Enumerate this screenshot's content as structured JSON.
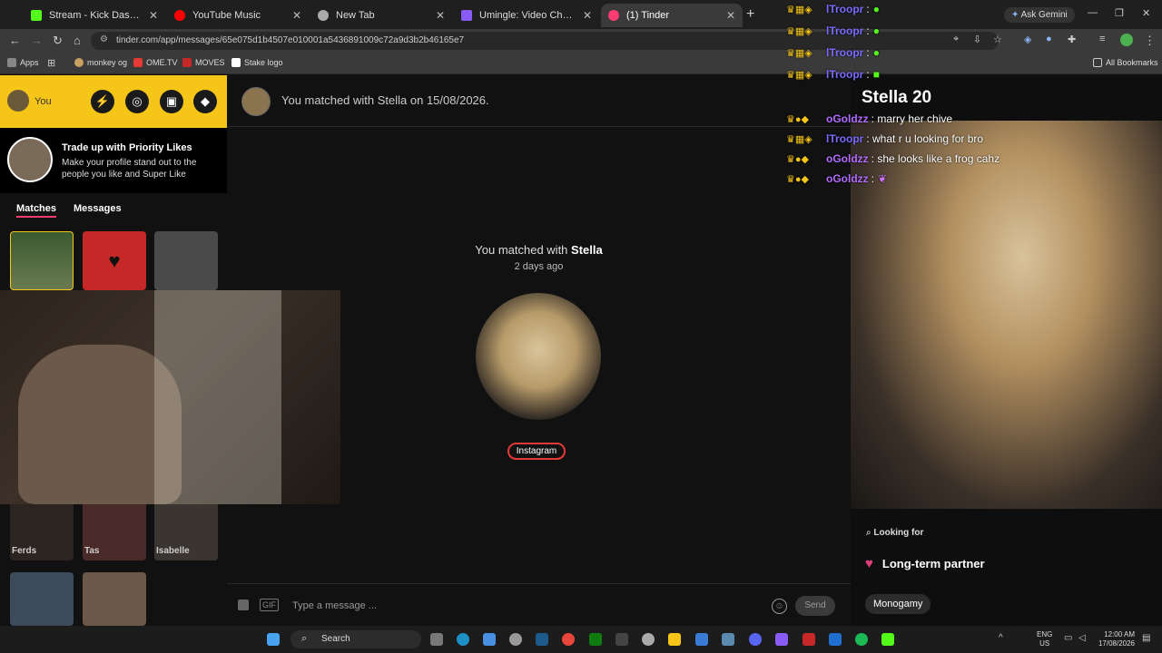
{
  "browser": {
    "tabs": [
      {
        "label": "Stream - Kick Dashboard",
        "color": "#53fc18"
      },
      {
        "label": "YouTube Music",
        "color": "#ff0000"
      },
      {
        "label": "New Tab",
        "color": "#aaaaaa"
      },
      {
        "label": "Umingle: Video Chat with S",
        "color": "#8a5cf6"
      },
      {
        "label": "(1) Tinder",
        "color": "#fe3c72"
      }
    ],
    "url": "tinder.com/app/messages/65e075d1b4507e010001a5436891009c72a9d3b2b46165e7",
    "ask_gemini": "Ask Gemini",
    "bookmarks": [
      "Apps",
      "monkey og",
      "OME.TV",
      "MOVES",
      "Stake logo"
    ],
    "all_bookmarks": "All Bookmarks"
  },
  "sidebar": {
    "you_label": "You",
    "promo_title": "Trade up with Priority Likes",
    "promo_text": "Make your profile stand out to the people you like and Super Like",
    "tab_matches": "Matches",
    "tab_messages": "Messages",
    "match_names": [
      "Ferds",
      "Tas",
      "Isabelle"
    ]
  },
  "conversation": {
    "header": "You matched with Stella on 15/08/2026.",
    "match_prefix": "You matched with ",
    "match_name": "Stella",
    "match_ago": "2 days ago",
    "instagram": "Instagram",
    "placeholder": "Type a message ...",
    "gif": "GIF",
    "send": "Send"
  },
  "profile": {
    "name": "Stella 20",
    "looking_for_label": "Looking for",
    "looking_for_value": "Long-term partner",
    "tag": "Monogamy"
  },
  "chat": [
    {
      "user": "lTroopr",
      "text": "",
      "color": "#7b6cff"
    },
    {
      "user": "lTroopr",
      "text": "",
      "color": "#7b6cff"
    },
    {
      "user": "lTroopr",
      "text": "",
      "color": "#7b6cff"
    },
    {
      "user": "lTroopr",
      "text": "",
      "color": "#7b6cff"
    },
    {
      "user": "oGoldzz",
      "text": "marry her chive",
      "color": "#b26cff"
    },
    {
      "user": "lTroopr",
      "text": "what r u looking for bro",
      "color": "#7b6cff"
    },
    {
      "user": "oGoldzz",
      "text": "she looks like a frog cahz",
      "color": "#b26cff"
    },
    {
      "user": "oGoldzz",
      "text": "",
      "color": "#b26cff"
    }
  ],
  "taskbar": {
    "search": "Search",
    "lang": "ENG",
    "region": "US",
    "time": "12:00 AM",
    "date": "17/08/2026"
  },
  "colors": {
    "tinder_accent": "#fe3c72",
    "gold_header": "#f5c518"
  }
}
